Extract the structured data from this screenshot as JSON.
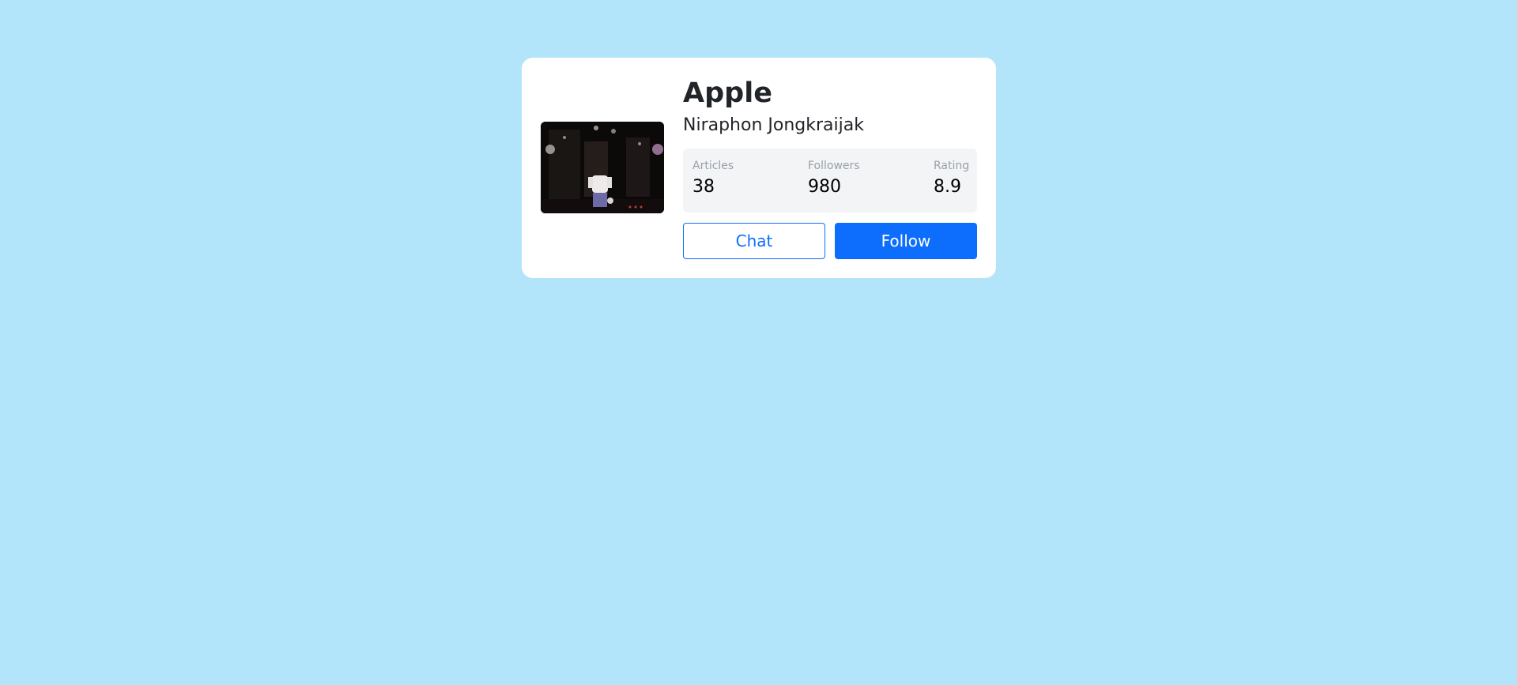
{
  "profile": {
    "title": "Apple",
    "name": "Niraphon Jongkraijak"
  },
  "stats": [
    {
      "label": "Articles",
      "value": "38"
    },
    {
      "label": "Followers",
      "value": "980"
    },
    {
      "label": "Rating",
      "value": "8.9"
    }
  ],
  "actions": {
    "chat_label": "Chat",
    "follow_label": "Follow"
  },
  "colors": {
    "page_background": "#b3e5fa",
    "card_background": "#ffffff",
    "primary": "#0d6efd",
    "stats_background": "#f2f4f6"
  }
}
